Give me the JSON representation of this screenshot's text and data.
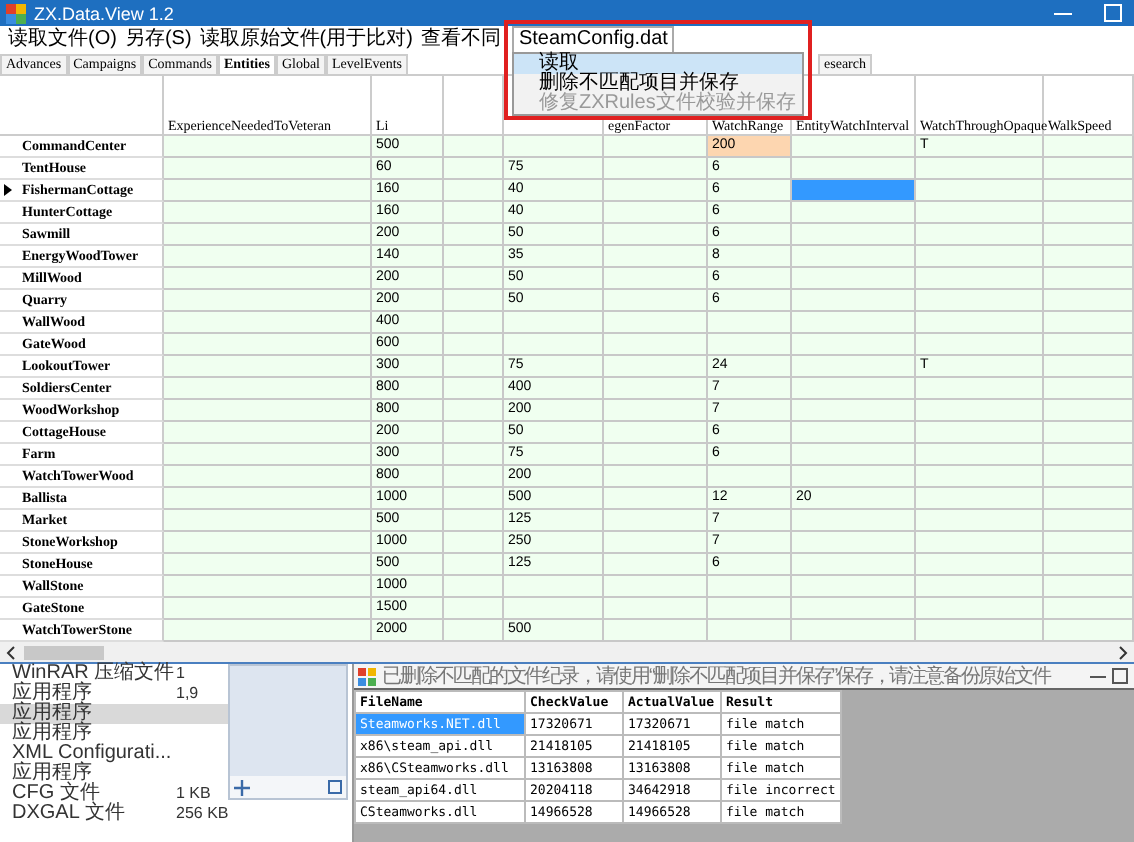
{
  "window": {
    "title": "ZX.Data.View 1.2"
  },
  "menu": [
    {
      "label": "读取文件(O)",
      "open": false
    },
    {
      "label": "另存(S)",
      "open": false
    },
    {
      "label": "读取原始文件(用于比对)",
      "open": false
    },
    {
      "label": "查看不同",
      "open": false
    },
    {
      "label": "SteamConfig.dat",
      "open": true
    }
  ],
  "dropdown": [
    {
      "label": "读取",
      "highlighted": true,
      "disabled": false
    },
    {
      "label": "删除不匹配项目并保存",
      "highlighted": false,
      "disabled": false
    },
    {
      "label": "修复ZXRules文件校验并保存",
      "highlighted": false,
      "disabled": true
    }
  ],
  "tabs": [
    {
      "label": "Advances",
      "selected": false
    },
    {
      "label": "Campaigns",
      "selected": false
    },
    {
      "label": "Commands",
      "selected": false
    },
    {
      "label": "Entities",
      "selected": true
    },
    {
      "label": "Global",
      "selected": false
    },
    {
      "label": "LevelEvents",
      "selected": false
    },
    {
      "label": "esearch",
      "selected": false
    }
  ],
  "grid": {
    "columns": [
      {
        "header": "ExperienceNeededToVeteran"
      },
      {
        "header": "Li"
      },
      {},
      {},
      {
        "header": "egenFactor"
      },
      {
        "header": "WatchRange"
      },
      {
        "header": "EntityWatchInterval"
      },
      {
        "header": "WatchThroughOpaque"
      },
      {
        "header": "WalkSpeed"
      }
    ],
    "rows": [
      {
        "name": "CommandCenter",
        "selected": false,
        "column_3": "500",
        "watch_range": "200",
        "watch_through_opaque": "T",
        "watch_range_edited": true
      },
      {
        "name": "TentHouse",
        "selected": false,
        "column_3": "60",
        "column_5": "75",
        "watch_range": "6"
      },
      {
        "name": "FishermanCottage",
        "selected": true,
        "column_3": "160",
        "column_5": "40",
        "watch_range": "6",
        "interval_selected": true
      },
      {
        "name": "HunterCottage",
        "selected": false,
        "column_3": "160",
        "column_5": "40",
        "watch_range": "6"
      },
      {
        "name": "Sawmill",
        "selected": false,
        "column_3": "200",
        "column_5": "50",
        "watch_range": "6"
      },
      {
        "name": "EnergyWoodTower",
        "selected": false,
        "column_3": "140",
        "column_5": "35",
        "watch_range": "8"
      },
      {
        "name": "MillWood",
        "selected": false,
        "column_3": "200",
        "column_5": "50",
        "watch_range": "6"
      },
      {
        "name": "Quarry",
        "selected": false,
        "column_3": "200",
        "column_5": "50",
        "watch_range": "6"
      },
      {
        "name": "WallWood",
        "selected": false,
        "column_3": "400"
      },
      {
        "name": "GateWood",
        "selected": false,
        "column_3": "600"
      },
      {
        "name": "LookoutTower",
        "selected": false,
        "column_3": "300",
        "column_5": "75",
        "watch_range": "24",
        "watch_through_opaque": "T"
      },
      {
        "name": "SoldiersCenter",
        "selected": false,
        "column_3": "800",
        "column_5": "400",
        "watch_range": "7"
      },
      {
        "name": "WoodWorkshop",
        "selected": false,
        "column_3": "800",
        "column_5": "200",
        "watch_range": "7"
      },
      {
        "name": "CottageHouse",
        "selected": false,
        "column_3": "200",
        "column_5": "50",
        "watch_range": "6"
      },
      {
        "name": "Farm",
        "selected": false,
        "column_3": "300",
        "column_5": "75",
        "watch_range": "6"
      },
      {
        "name": "WatchTowerWood",
        "selected": false,
        "column_3": "800",
        "column_5": "200"
      },
      {
        "name": "Ballista",
        "selected": false,
        "column_3": "1000",
        "column_5": "500",
        "watch_range": "12",
        "entity_watch_interval": "20"
      },
      {
        "name": "Market",
        "selected": false,
        "column_3": "500",
        "column_5": "125",
        "watch_range": "7"
      },
      {
        "name": "StoneWorkshop",
        "selected": false,
        "column_3": "1000",
        "column_5": "250",
        "watch_range": "7"
      },
      {
        "name": "StoneHouse",
        "selected": false,
        "column_3": "500",
        "column_5": "125",
        "watch_range": "6"
      },
      {
        "name": "WallStone",
        "selected": false,
        "column_3": "1000"
      },
      {
        "name": "GateStone",
        "selected": false,
        "column_3": "1500"
      },
      {
        "name": "WatchTowerStone",
        "selected": false,
        "column_3": "2000",
        "column_5": "500"
      }
    ]
  },
  "explorer": [
    {
      "name": "WinRAR 压缩文件",
      "size": "1",
      "selected": false
    },
    {
      "name": "应用程序",
      "size": "1,9",
      "selected": false
    },
    {
      "name": "应用程序",
      "selected": true
    },
    {
      "name": "应用程序",
      "selected": false
    },
    {
      "name": "XML Configurati...",
      "selected": false
    },
    {
      "name": "应用程序",
      "selected": false
    },
    {
      "name": "CFG 文件",
      "size": "1 KB",
      "selected": false
    },
    {
      "name": "DXGAL 文件",
      "size": "256 KB",
      "selected": false
    }
  ],
  "dialog": {
    "title": "已删除不匹配的文件纪录，请使用“删除不匹配项目并保存”保存，请注意备份原始文件",
    "columns": [
      "FileName",
      "CheckValue",
      "ActualValue",
      "Result"
    ],
    "rows": [
      {
        "cells": [
          "Steamworks.NET.dll",
          "17320671",
          "17320671",
          "file match"
        ],
        "selected": true
      },
      {
        "cells": [
          "x86\\steam_api.dll",
          "21418105",
          "21418105",
          "file match"
        ],
        "selected": false
      },
      {
        "cells": [
          "x86\\CSteamworks.dll",
          "13163808",
          "13163808",
          "file match"
        ],
        "selected": false
      },
      {
        "cells": [
          "steam_api64.dll",
          "20204118",
          "34642918",
          "file incorrect"
        ],
        "selected": false
      },
      {
        "cells": [
          "CSteamworks.dll",
          "14966528",
          "14966528",
          "file match"
        ],
        "selected": false
      }
    ]
  }
}
